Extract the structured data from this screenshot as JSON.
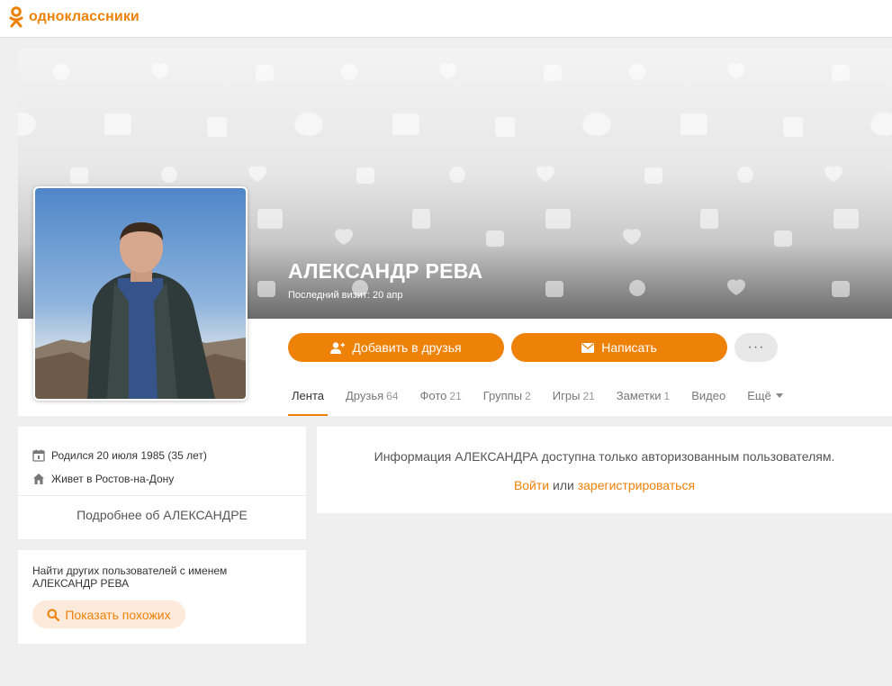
{
  "header": {
    "logo_text": "одноклассники",
    "logo_icon": "ok-logo-icon"
  },
  "profile": {
    "name": "АЛЕКСАНДР РЕВА",
    "last_visit": "Последний визит: 20 апр",
    "add_friend_label": "Добавить в друзья",
    "message_label": "Написать",
    "more_label": "···"
  },
  "tabs": [
    {
      "label": "Лента",
      "count": ""
    },
    {
      "label": "Друзья",
      "count": "64"
    },
    {
      "label": "Фото",
      "count": "21"
    },
    {
      "label": "Группы",
      "count": "2"
    },
    {
      "label": "Игры",
      "count": "21"
    },
    {
      "label": "Заметки",
      "count": "1"
    },
    {
      "label": "Видео",
      "count": ""
    },
    {
      "label": "Ещё",
      "count": ""
    }
  ],
  "about": {
    "born": "Родился 20 июля 1985 (35 лет)",
    "lives": "Живет в Ростов-на-Дону",
    "more_link": "Подробнее об АЛЕКСАНДРЕ"
  },
  "find": {
    "text": "Найти других пользователей с именем АЛЕКСАНДР РЕВА",
    "button_label": "Показать похожих"
  },
  "auth": {
    "message": "Информация АЛЕКСАНДРА доступна только авторизованным пользователям.",
    "login_label": "Войти",
    "or_label": "или",
    "register_label": "зарегистрироваться"
  },
  "colors": {
    "accent": "#ee8208",
    "accent_light": "#fdeadb",
    "page_bg": "#efefef"
  }
}
